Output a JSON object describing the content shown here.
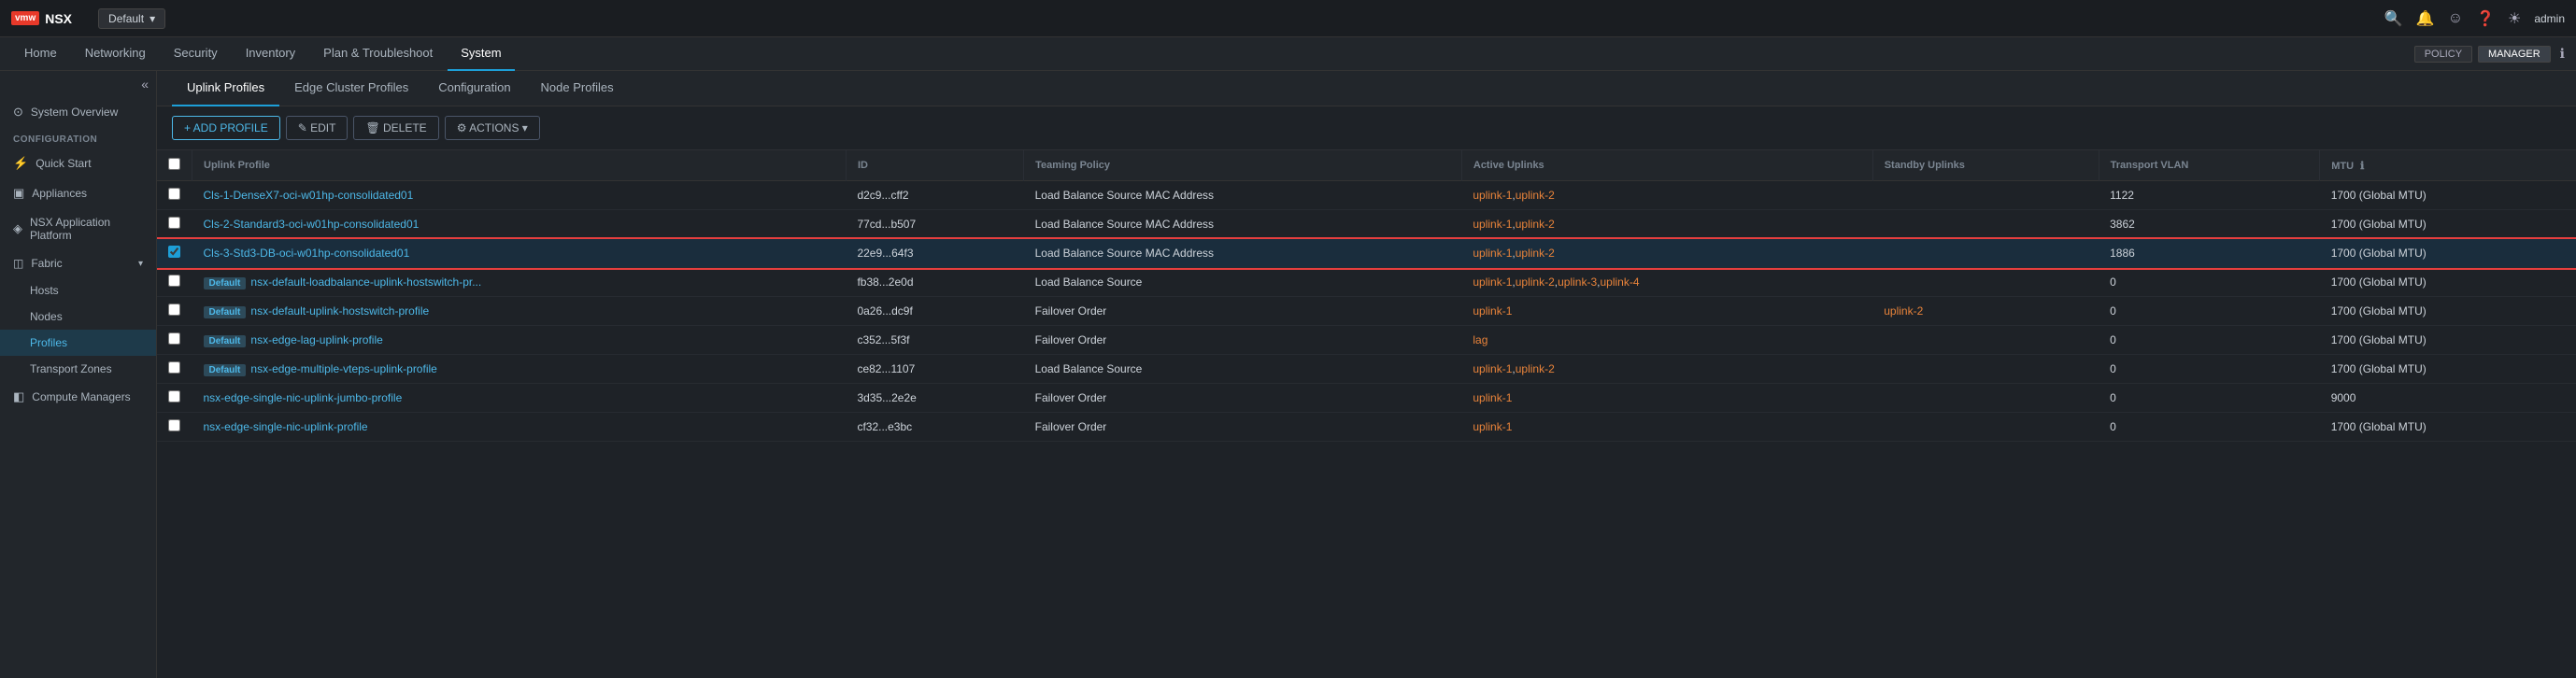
{
  "app": {
    "logo_text": "vmw",
    "title": "NSX",
    "env": "Default"
  },
  "topbar": {
    "icons": [
      "search",
      "bell",
      "smiley",
      "help",
      "sun"
    ],
    "user": "admin"
  },
  "navbar": {
    "items": [
      {
        "label": "Home",
        "active": false
      },
      {
        "label": "Networking",
        "active": false
      },
      {
        "label": "Security",
        "active": false
      },
      {
        "label": "Inventory",
        "active": false
      },
      {
        "label": "Plan & Troubleshoot",
        "active": false
      },
      {
        "label": "System",
        "active": true
      }
    ],
    "pills": [
      {
        "label": "POLICY",
        "active": false
      },
      {
        "label": "MANAGER",
        "active": true
      }
    ]
  },
  "sidebar": {
    "section_title": "Configuration",
    "items": [
      {
        "label": "System Overview",
        "icon": "⊙",
        "active": false
      },
      {
        "label": "Quick Start",
        "icon": "⚡",
        "active": false
      },
      {
        "label": "Appliances",
        "icon": "▣",
        "active": false
      },
      {
        "label": "NSX Application Platform",
        "icon": "◈",
        "active": false
      },
      {
        "label": "Fabric",
        "icon": "◫",
        "expandable": true,
        "active": false
      },
      {
        "label": "Hosts",
        "sublevel": true,
        "active": false
      },
      {
        "label": "Nodes",
        "sublevel": true,
        "active": false
      },
      {
        "label": "Profiles",
        "sublevel": true,
        "active": true
      },
      {
        "label": "Transport Zones",
        "sublevel": true,
        "active": false
      },
      {
        "label": "Compute Managers",
        "sublevel": false,
        "active": false
      }
    ]
  },
  "content_tabs": [
    {
      "label": "Uplink Profiles",
      "active": true
    },
    {
      "label": "Edge Cluster Profiles",
      "active": false
    },
    {
      "label": "Configuration",
      "active": false
    },
    {
      "label": "Node Profiles",
      "active": false
    }
  ],
  "toolbar": {
    "add_label": "+ ADD PROFILE",
    "edit_label": "✎ EDIT",
    "delete_label": "🗑 DELETE",
    "actions_label": "⚙ ACTIONS ▾"
  },
  "table": {
    "columns": [
      {
        "key": "name",
        "label": "Uplink Profile"
      },
      {
        "key": "id",
        "label": "ID"
      },
      {
        "key": "teaming_policy",
        "label": "Teaming Policy"
      },
      {
        "key": "active_uplinks",
        "label": "Active Uplinks"
      },
      {
        "key": "standby_uplinks",
        "label": "Standby Uplinks"
      },
      {
        "key": "transport_vlan",
        "label": "Transport VLAN"
      },
      {
        "key": "mtu",
        "label": "MTU"
      }
    ],
    "rows": [
      {
        "id": 1,
        "name": "Cls-1-DenseX7-oci-w01hp-consolidated01",
        "default": false,
        "row_id": "d2c9...cff2",
        "teaming_policy": "Load Balance Source MAC Address",
        "active_uplinks": "uplink-1,uplink-2",
        "standby_uplinks": "",
        "transport_vlan": "1122",
        "mtu": "1700 (Global MTU)",
        "selected": false
      },
      {
        "id": 2,
        "name": "Cls-2-Standard3-oci-w01hp-consolidated01",
        "default": false,
        "row_id": "77cd...b507",
        "teaming_policy": "Load Balance Source MAC Address",
        "active_uplinks": "uplink-1,uplink-2",
        "standby_uplinks": "",
        "transport_vlan": "3862",
        "mtu": "1700 (Global MTU)",
        "selected": false
      },
      {
        "id": 3,
        "name": "Cls-3-Std3-DB-oci-w01hp-consolidated01",
        "default": false,
        "row_id": "22e9...64f3",
        "teaming_policy": "Load Balance Source MAC Address",
        "active_uplinks": "uplink-1,uplink-2",
        "standby_uplinks": "",
        "transport_vlan": "1886",
        "mtu": "1700 (Global MTU)",
        "selected": true
      },
      {
        "id": 4,
        "name": "nsx-default-loadbalance-uplink-hostswitch-pr...",
        "default": true,
        "row_id": "fb38...2e0d",
        "teaming_policy": "Load Balance Source",
        "active_uplinks": "uplink-1,uplink-2,uplink-3,uplink-4",
        "standby_uplinks": "",
        "transport_vlan": "0",
        "mtu": "1700 (Global MTU)",
        "selected": false
      },
      {
        "id": 5,
        "name": "nsx-default-uplink-hostswitch-profile",
        "default": true,
        "row_id": "0a26...dc9f",
        "teaming_policy": "Failover Order",
        "active_uplinks": "uplink-1",
        "standby_uplinks": "uplink-2",
        "transport_vlan": "0",
        "mtu": "1700 (Global MTU)",
        "selected": false
      },
      {
        "id": 6,
        "name": "nsx-edge-lag-uplink-profile",
        "default": true,
        "row_id": "c352...5f3f",
        "teaming_policy": "Failover Order",
        "active_uplinks": "lag",
        "standby_uplinks": "",
        "transport_vlan": "0",
        "mtu": "1700 (Global MTU)",
        "selected": false
      },
      {
        "id": 7,
        "name": "nsx-edge-multiple-vteps-uplink-profile",
        "default": true,
        "row_id": "ce82...1107",
        "teaming_policy": "Load Balance Source",
        "active_uplinks": "uplink-1,uplink-2",
        "standby_uplinks": "",
        "transport_vlan": "0",
        "mtu": "1700 (Global MTU)",
        "selected": false
      },
      {
        "id": 8,
        "name": "nsx-edge-single-nic-uplink-jumbo-profile",
        "default": false,
        "row_id": "3d35...2e2e",
        "teaming_policy": "Failover Order",
        "active_uplinks": "uplink-1",
        "standby_uplinks": "",
        "transport_vlan": "0",
        "mtu": "9000",
        "selected": false
      },
      {
        "id": 9,
        "name": "nsx-edge-single-nic-uplink-profile",
        "default": false,
        "row_id": "cf32...e3bc",
        "teaming_policy": "Failover Order",
        "active_uplinks": "uplink-1",
        "standby_uplinks": "",
        "transport_vlan": "0",
        "mtu": "1700 (Global MTU)",
        "selected": false
      }
    ]
  }
}
